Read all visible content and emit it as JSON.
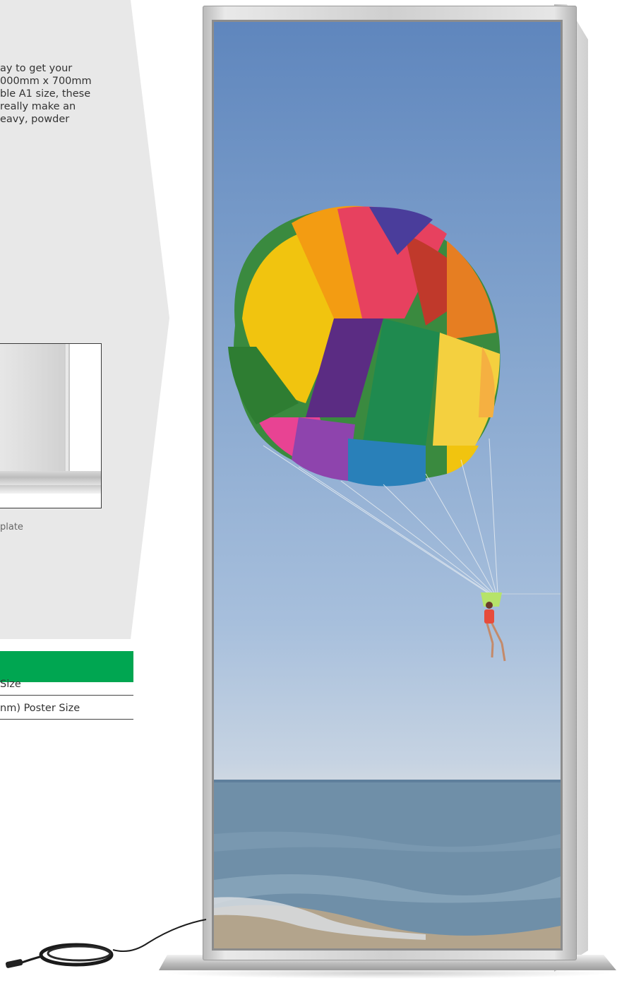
{
  "intro": {
    "lines": [
      "ay to get your",
      "000mm x 700mm",
      "ble A1 size, these",
      " really make an",
      "eavy, powder"
    ]
  },
  "photo": {
    "caption": "plate"
  },
  "sizes": {
    "items": [
      "Size",
      "nm) Poster Size"
    ]
  },
  "colors": {
    "panel_bg": "#e8e8e8",
    "accent_green": "#00a651"
  },
  "icons": {
    "cable": "power-cable-icon"
  }
}
